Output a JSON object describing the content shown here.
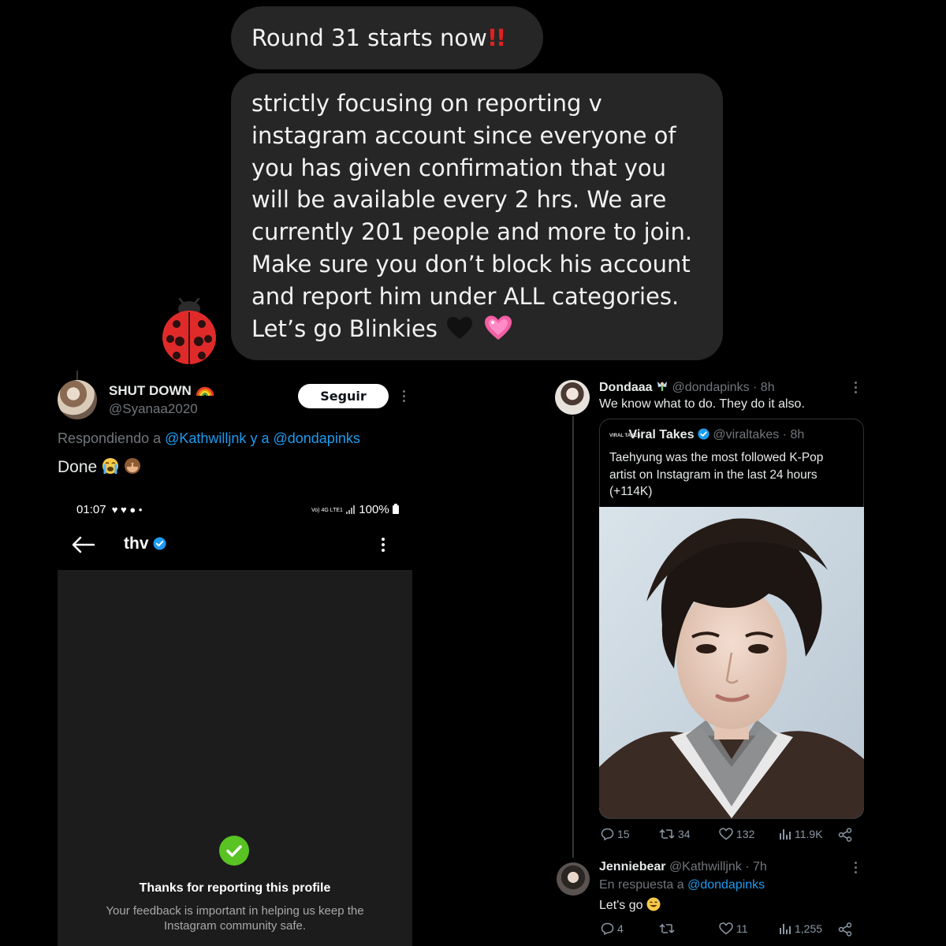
{
  "chat": {
    "message1": "Round 31 starts now",
    "message1_emoji": "!!",
    "message2_lines": [
      "strictly focusing on reporting v",
      "instagram account since everyone of",
      "you has given confirmation that you",
      "will be available every 2 hrs. We are",
      "currently 201 people and more to join.",
      "Make sure you don’t block his account",
      "and report him under ALL categories.",
      "Let’s go Blinkies"
    ],
    "reaction_icon": "ladybug-icon"
  },
  "left_tweet": {
    "display_name": "SHUT DOWN",
    "handle": "@Syanaa2020",
    "follow_label": "Seguir",
    "replying_prefix": "Respondiendo a",
    "replying_to_1": "@Kathwilljnk",
    "replying_joiner": "y a",
    "replying_to_2": "@dondapinks",
    "text": "Done"
  },
  "phone": {
    "time": "01:07",
    "network": "Vo) 4G LTE1",
    "battery": "100%",
    "profile_name": "thv",
    "confirm_title": "Thanks for reporting this profile",
    "confirm_line1": "Your feedback is important in helping us keep the",
    "confirm_line2": "Instagram community safe."
  },
  "right_tweet": {
    "display_name": "Dondaaa",
    "handle": "@dondapinks",
    "time": "· 8h",
    "text": "We know what to do. They do it also.",
    "quote": {
      "display_name": "Viral Takes",
      "handle": "@viraltakes",
      "time": "· 8h",
      "line1": "Taehyung was the most followed K-Pop",
      "line2": "artist on Instagram in the last 24 hours",
      "line3": "(+114K)"
    },
    "stats": {
      "replies": "15",
      "retweets": "34",
      "likes": "132",
      "views": "11.9K"
    }
  },
  "reply_tweet": {
    "display_name": "Jenniebear",
    "handle": "@Kathwilljnk",
    "time": "· 7h",
    "replying_prefix": "En respuesta a",
    "replying_to": "@dondapinks",
    "text": "Let's go",
    "stats": {
      "replies": "4",
      "retweets": "",
      "likes": "11",
      "views": "1,255"
    }
  },
  "colors": {
    "link": "#1d9bf0",
    "muted": "#71767b",
    "bubble": "#262626",
    "verified": "#1d9bf0",
    "check": "#58c322"
  }
}
